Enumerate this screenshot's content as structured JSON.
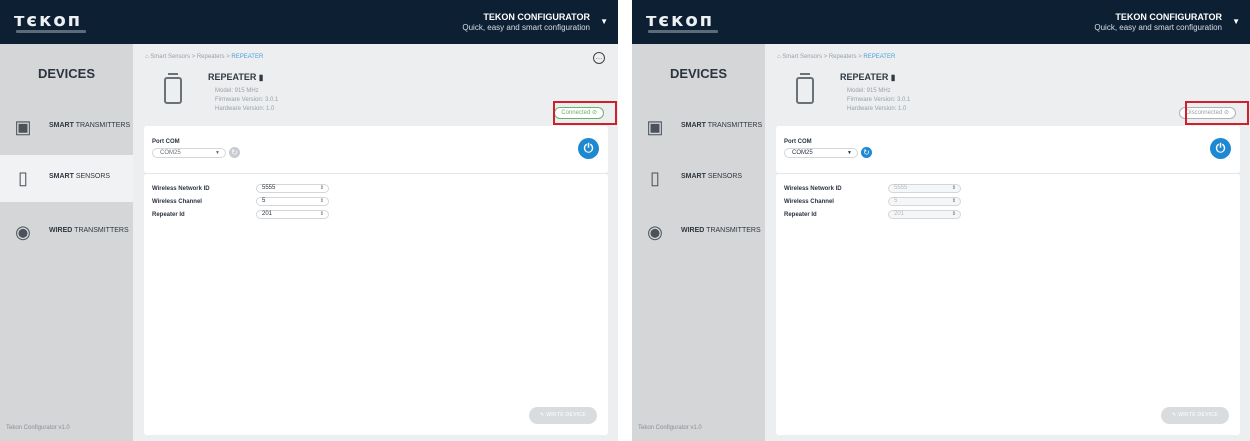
{
  "panels": [
    {
      "header": {
        "logo_text": "тєкоп",
        "brand_title": "TEKON CONFIGURATOR",
        "brand_subtitle": "Quick, easy and smart configuration",
        "caret": "▼"
      },
      "sidebar": {
        "title": "DEVICES",
        "items": [
          {
            "bold": "SMART",
            "rest": " TRANSMITTERS",
            "icon": "transmitter-icon",
            "active": false
          },
          {
            "bold": "SMART",
            "rest": " SENSORS",
            "icon": "sensor-icon",
            "active": true
          },
          {
            "bold": "WIRED",
            "rest": " TRANSMITTERS",
            "icon": "wired-transmitter-icon",
            "active": false
          }
        ],
        "footer": "Tekon Configurator v1.0"
      },
      "breadcrumb": {
        "root": "Smart Sensors",
        "mid": "Repeaters",
        "current": "REPEATER",
        "sep": ">"
      },
      "device": {
        "name": "REPEATER",
        "model": "Model: 915 MHz",
        "firmware": "Firmware Version: 3.0.1",
        "hardware": "Hardware Version: 1.0"
      },
      "status": {
        "text": "Connected ⊘",
        "state": "connected",
        "color": "#6bb36b"
      },
      "port": {
        "label": "Port COM",
        "value": "COM25",
        "refresh_enabled": false
      },
      "form": {
        "fields": [
          {
            "label": "Wireless Network ID",
            "value": "5555"
          },
          {
            "label": "Wireless Channel",
            "value": "5"
          },
          {
            "label": "Repeater Id",
            "value": "201"
          }
        ],
        "enabled": true
      },
      "write_button": "WRITE DEVICE"
    },
    {
      "header": {
        "logo_text": "тєкоп",
        "brand_title": "TEKON CONFIGURATOR",
        "brand_subtitle": "Quick, easy and smart configuration",
        "caret": "▼"
      },
      "sidebar": {
        "title": "DEVICES",
        "items": [
          {
            "bold": "SMART",
            "rest": " TRANSMITTERS",
            "icon": "transmitter-icon",
            "active": false
          },
          {
            "bold": "SMART",
            "rest": " SENSORS",
            "icon": "sensor-icon",
            "active": false
          },
          {
            "bold": "WIRED",
            "rest": " TRANSMITTERS",
            "icon": "wired-transmitter-icon",
            "active": false
          }
        ],
        "footer": "Tekon Configurator v1.0"
      },
      "breadcrumb": {
        "root": "Smart Sensors",
        "mid": "Repeaters",
        "current": "REPEATER",
        "sep": ">"
      },
      "device": {
        "name": "REPEATER",
        "model": "Model: 915 MHz",
        "firmware": "Firmware Version: 3.0.1",
        "hardware": "Hardware Version: 1.0"
      },
      "status": {
        "text": "Disconnected ⊘",
        "state": "disconnected",
        "color": "#9aa1a8"
      },
      "port": {
        "label": "Port COM",
        "value": "COM25",
        "refresh_enabled": true
      },
      "form": {
        "fields": [
          {
            "label": "Wireless Network ID",
            "value": "5555"
          },
          {
            "label": "Wireless Channel",
            "value": "5"
          },
          {
            "label": "Repeater Id",
            "value": "201"
          }
        ],
        "enabled": false
      },
      "write_button": "WRITE DEVICE"
    }
  ],
  "colors": {
    "topbar": "#0c1f33",
    "accent": "#1e88d0",
    "highlight": "#d0202c",
    "sidebar": "#d4d6d8"
  }
}
